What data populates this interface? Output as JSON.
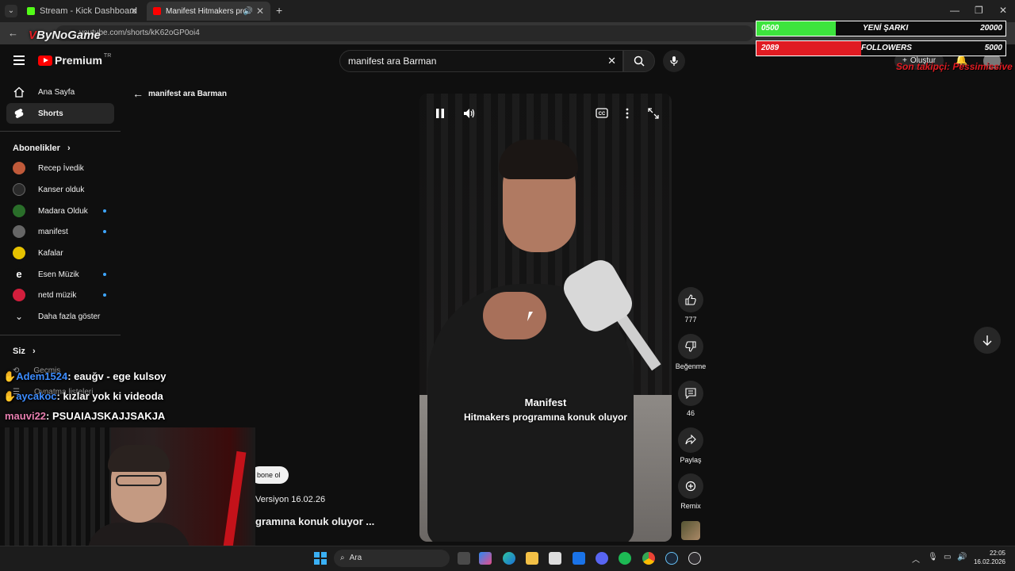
{
  "browser": {
    "tabs": [
      {
        "title": "Stream - Kick Dashboard",
        "favicon_color": "#53fc18"
      },
      {
        "title": "Manifest Hitmakers program",
        "favicon_color": "#ff0000"
      }
    ],
    "url": "youtube.com/shorts/kK62oGP0oi4",
    "watermark": "ByNoGame"
  },
  "header": {
    "logo": "Premium",
    "region": "TR",
    "search_value": "manifest ara Barman",
    "create_label": "Oluştur"
  },
  "sidebar": {
    "items": [
      {
        "label": "Ana Sayfa",
        "icon": "home-icon"
      },
      {
        "label": "Shorts",
        "icon": "shorts-icon"
      }
    ],
    "subs_title": "Abonelikler",
    "subscriptions": [
      {
        "label": "Recep İvedik",
        "color": "#c05a3a",
        "dot": false
      },
      {
        "label": "Kanser olduk",
        "color": "#2a2a2a",
        "dot": false
      },
      {
        "label": "Madara Olduk",
        "color": "#2a6e2a",
        "dot": true
      },
      {
        "label": "manifest",
        "color": "#666666",
        "dot": true
      },
      {
        "label": "Kafalar",
        "color": "#e6c200",
        "dot": false
      },
      {
        "label": "Esen Müzik",
        "color": "#0f0f0f",
        "dot": true
      },
      {
        "label": "netd müzik",
        "color": "#d21e3c",
        "dot": true
      }
    ],
    "show_more": "Daha fazla göster",
    "you_title": "Siz",
    "you_items": [
      "Geçmiş",
      "Oynatma listeleri"
    ]
  },
  "back_query": "manifest ara Barman",
  "video": {
    "caption_title": "Manifest",
    "caption_sub": "Hitmakers programına konuk oluyor"
  },
  "actions": {
    "likes": "777",
    "dislike_label": "Beğenme",
    "comments": "46",
    "share_label": "Paylaş",
    "remix_label": "Remix"
  },
  "left_meta": {
    "subscribe": "bone ol",
    "version": "Versiyon 16.02.26",
    "title": "gramına konuk oluyor ..."
  },
  "overlay": {
    "songs": {
      "current": "0500",
      "label": "YENİ ŞARKI",
      "goal": "20000",
      "progress": 0.32,
      "color": "#3de43d"
    },
    "followers": {
      "current": "2089",
      "label": "FOLLOWERS",
      "goal": "5000",
      "progress": 0.42,
      "color": "#e01b22"
    },
    "last_follower": "Son takipçi: Pessimissive"
  },
  "chat": [
    {
      "user": "Adem1524",
      "msg": ": eauğv - ege kulsoy",
      "color": "#3c8cff"
    },
    {
      "user": "aycakoc",
      "msg": ": kızlar yok ki videoda",
      "color": "#3c8cff"
    },
    {
      "user": "mauvi22",
      "msg": ": PSUAIAJSKAJJSAKJA",
      "color": "#e87fb0"
    }
  ],
  "taskbar": {
    "search": "Ara",
    "time": "22:05",
    "date": "16.02.2026"
  }
}
